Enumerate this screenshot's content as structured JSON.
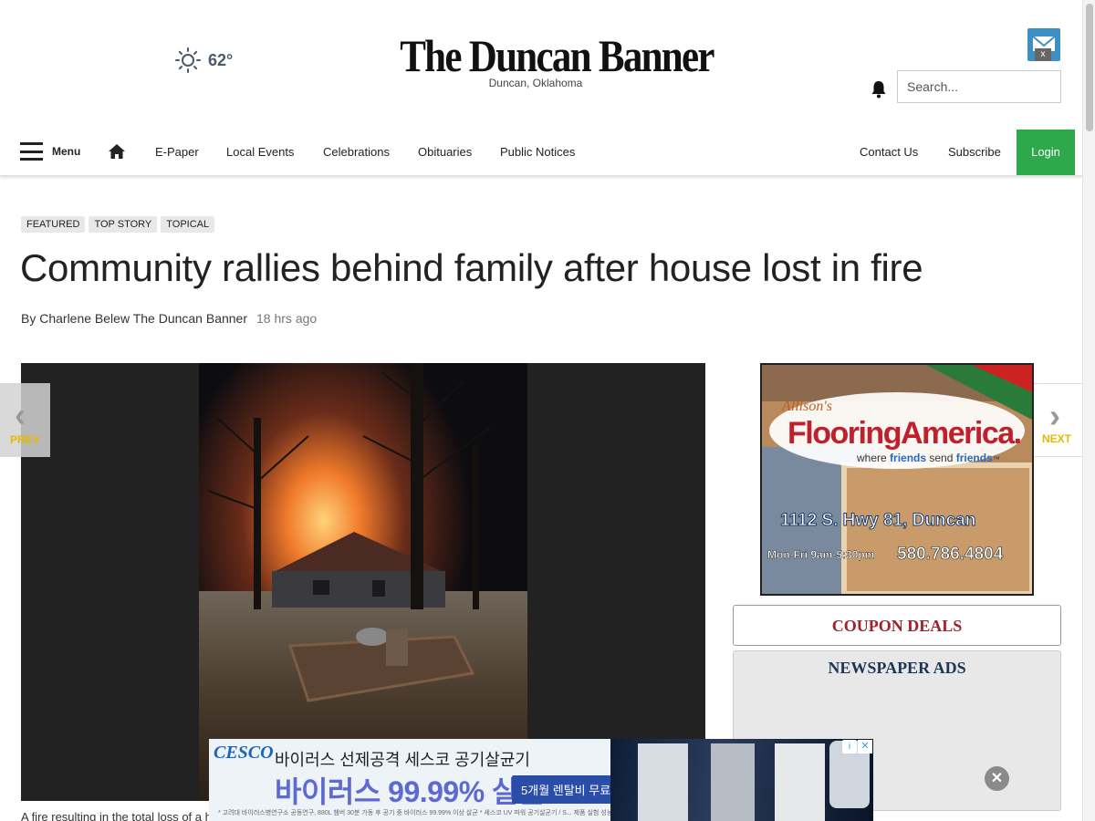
{
  "header": {
    "temperature": "62°",
    "site_title": "The Duncan Banner",
    "site_location": "Duncan, Oklahoma",
    "search_placeholder": "Search...",
    "mail_close": "x"
  },
  "nav": {
    "menu_label": "Menu",
    "links": [
      "E-Paper",
      "Local Events",
      "Celebrations",
      "Obituaries",
      "Public Notices"
    ],
    "right_links": [
      "Contact Us",
      "Subscribe"
    ],
    "login_label": "Login"
  },
  "article": {
    "tags": [
      "FEATURED",
      "TOP STORY",
      "TOPICAL"
    ],
    "headline": "Community rallies behind family after house lost in fire",
    "byline": "By Charlene Belew The Duncan Banner",
    "time_ago": "18 hrs ago",
    "caption": "A fire resulting in the total loss of a h"
  },
  "pager": {
    "prev_label": "PREV",
    "next_label": "NEXT"
  },
  "sidebar": {
    "flooring_ad": {
      "brand_small": "Allison's",
      "brand": "FlooringAmerica.",
      "tagline_pre": "where ",
      "tagline_friends1": "friends",
      "tagline_mid": " send ",
      "tagline_friends2": "friends",
      "tagline_tm": "™",
      "address": "1112 S. Hwy 81, Duncan",
      "hours": "Mon-Fri 9am-5:30pm",
      "phone": "580.786.4804"
    },
    "coupon_label": "COUPON DEALS",
    "newspaper_ads_label": "NEWSPAPER ADS"
  },
  "bottom_ad": {
    "brand": "CESCO",
    "line1": "바이러스 선제공격 세스코 공기살균기",
    "line2": "바이러스 99.99% 살균",
    "pill": "5개월 렌탈비 무료 〉",
    "fine_print": "* 고려대 바이러스병연구소 공동연구, 880L 챔버 30분 가동 후 공기 중 바이러스 99.99% 이상 살균   * 세스코 UV 파워 공기살균기 / S... 제품 실험 성능 기준으로 사용 환경에 따라 다를 수 있음"
  },
  "colors": {
    "login_green": "#2ea84a",
    "coupon_red": "#a0212b",
    "ads_navy": "#1d3557",
    "pager_gold": "#e6b800"
  }
}
